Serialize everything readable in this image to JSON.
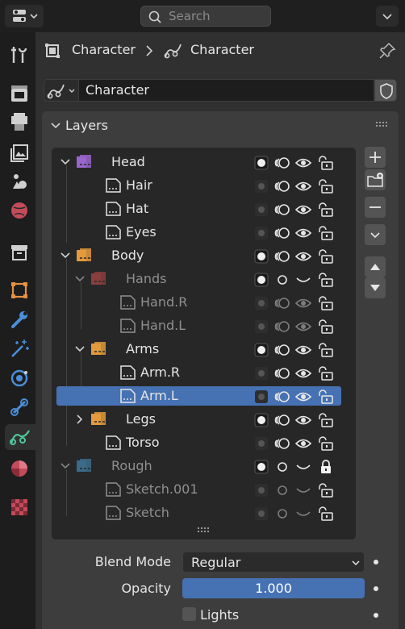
{
  "header": {
    "search_placeholder": "Search"
  },
  "breadcrumb": {
    "object_name": "Character",
    "data_name": "Character"
  },
  "datablock": {
    "name": "Character"
  },
  "panel": {
    "title": "Layers"
  },
  "layers": [
    {
      "name": "Head",
      "kind": "group",
      "color": "#9966cc",
      "expanded": true
    },
    {
      "name": "Hair",
      "kind": "layer"
    },
    {
      "name": "Hat",
      "kind": "layer"
    },
    {
      "name": "Eyes",
      "kind": "layer"
    },
    {
      "name": "Body",
      "kind": "group",
      "color": "#e39a3d",
      "expanded": true
    },
    {
      "name": "Hands",
      "kind": "group",
      "color": "#d9544f",
      "expanded": true,
      "dim": true
    },
    {
      "name": "Hand.R",
      "kind": "layer",
      "dim": true
    },
    {
      "name": "Hand.L",
      "kind": "layer",
      "dim": true
    },
    {
      "name": "Arms",
      "kind": "group",
      "color": "#e39a3d",
      "expanded": true
    },
    {
      "name": "Arm.R",
      "kind": "layer"
    },
    {
      "name": "Arm.L",
      "kind": "layer",
      "selected": true
    },
    {
      "name": "Legs",
      "kind": "group",
      "color": "#e39a3d",
      "expanded": false
    },
    {
      "name": "Torso",
      "kind": "layer"
    },
    {
      "name": "Rough",
      "kind": "group",
      "color": "#4ca3d9",
      "expanded": true,
      "dim": true,
      "locked": true
    },
    {
      "name": "Sketch.001",
      "kind": "layer",
      "dim": true
    },
    {
      "name": "Sketch",
      "kind": "layer",
      "dim": true
    }
  ],
  "properties": {
    "blend_mode_label": "Blend Mode",
    "blend_mode_value": "Regular",
    "opacity_label": "Opacity",
    "opacity_value": "1.000",
    "lights_label": "Lights"
  },
  "colors": {
    "accent": "#4672b4",
    "panel": "#3d3d3d",
    "background": "#303030"
  }
}
